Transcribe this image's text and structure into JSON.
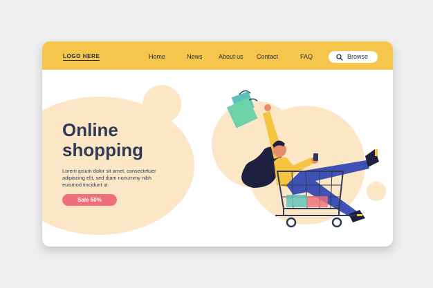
{
  "header": {
    "logo": "LOGO HERE",
    "nav": [
      {
        "label": "Home"
      },
      {
        "label": "News"
      },
      {
        "label": "About us"
      },
      {
        "label": "Contact"
      },
      {
        "label": "FAQ"
      }
    ],
    "browse_label": "Browse"
  },
  "hero": {
    "title_line1": "Online",
    "title_line2": "shopping",
    "body_lines": [
      "Lorem ipsum dolor sit amet, consectetuer",
      "adipiscing elit, sed diam nonummy nibh",
      "euismod tincidunt ut"
    ],
    "sale_label": "Sale 50%"
  },
  "colors": {
    "header": "#f6c64c",
    "blob": "#fbe7c6",
    "text": "#2e3a55",
    "sale": "#ee6f7c",
    "trousers": "#3f51b5",
    "bag_teal": "#5cc2b8"
  },
  "icons": {
    "browse": "search-icon"
  }
}
